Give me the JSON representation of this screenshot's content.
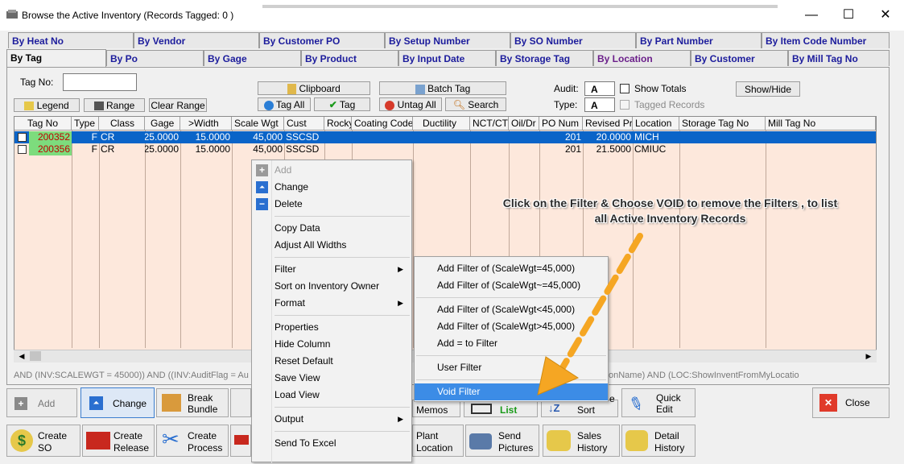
{
  "window": {
    "title": "Browse the Active Inventory  (Records Tagged:  0 )",
    "minimize_glyph": "—",
    "maximize_glyph": "☐",
    "close_glyph": "✕"
  },
  "tabs_row1": [
    "By Heat No",
    "By Vendor",
    "By Customer PO",
    "By Setup Number",
    "By SO Number",
    "By Part Number",
    "By Item Code Number"
  ],
  "tabs_row2": [
    "By Tag",
    "By Po",
    "By Gage",
    "By Product",
    "By Input Date",
    "By Storage Tag",
    "By Location",
    "By Customer",
    "By Mill Tag No"
  ],
  "filter_bar": {
    "tag_no_label": "Tag No:",
    "tag_no_value": "",
    "legend_label": "Legend",
    "range_label": "Range",
    "clear_range_label": "Clear Range",
    "clipboard_label": "Clipboard",
    "tag_all_label": "Tag All",
    "tag_label": "Tag",
    "batch_tag_label": "Batch Tag",
    "untag_all_label": "Untag All",
    "search_label": "Search",
    "audit_label": "Audit:",
    "audit_value": "A",
    "type_label": "Type:",
    "type_value": "A",
    "show_totals_label": "Show Totals",
    "tagged_records_label": "Tagged Records",
    "show_hide_label": "Show/Hide"
  },
  "grid": {
    "columns": [
      "Tag No",
      "Type",
      "Class",
      "Gage",
      ">Width",
      "Scale Wgt",
      "Cust",
      "Rocky",
      "Coating Code",
      "Ductility",
      "NCT/CT",
      "Oil/Dr",
      "PO Num",
      "Revised Pri",
      "Location",
      "Storage Tag No",
      "Mill Tag No"
    ],
    "rows": [
      {
        "tag_no": "200352",
        "type": "F",
        "class": "CR",
        "gage": "25.0000",
        "width": "15.0000",
        "scale_wgt": "45,000",
        "cust": "SSCSD",
        "po_num": "201",
        "revised_price": "20.0000",
        "location": "MICH",
        "selected": true
      },
      {
        "tag_no": "200356",
        "type": "F",
        "class": "CR",
        "gage": "25.0000",
        "width": "15.0000",
        "scale_wgt": "45,000",
        "cust": "SSCSD",
        "po_num": "201",
        "revised_price": "21.5000",
        "location": "CMIUC",
        "selected": false
      }
    ],
    "selected_color": "#0a64c8",
    "row_bg": "#fde8dc"
  },
  "filter_expression_left": "AND (INV:SCALEWGT = 45000)) AND ((INV:AuditFlag = Au",
  "filter_expression_right": "onName) AND (LOC:ShowInventFromMyLocatio",
  "context_menu": {
    "add": "Add",
    "change": "Change",
    "delete": "Delete",
    "copy_data": "Copy Data",
    "adjust_widths": "Adjust All Widths",
    "filter": "Filter",
    "sort_owner": "Sort on Inventory Owner",
    "format": "Format",
    "properties": "Properties",
    "hide_column": "Hide Column",
    "reset_default": "Reset Default",
    "save_view": "Save View",
    "load_view": "Load View",
    "output": "Output",
    "send_excel": "Send To Excel"
  },
  "filter_submenu": {
    "eq": "Add Filter of (ScaleWgt=45,000)",
    "neq": "Add Filter of (ScaleWgt~=45,000)",
    "lt": "Add Filter of (ScaleWgt<45,000)",
    "gt": "Add Filter of (ScaleWgt>45,000)",
    "add_eq": "Add = to Filter",
    "user": "User Filter",
    "void": "Void Filter"
  },
  "annotation": {
    "line1": "Click on the Filter & Choose VOID to remove the Filters , to list",
    "line2": "all Active Inventory Records"
  },
  "bottom_buttons": {
    "add": "Add",
    "change": "Change",
    "break_bundle_1": "Break",
    "break_bundle_2": "Bundle",
    "memos": "Memos",
    "list": "List",
    "sort": "Sort",
    "e_partial": "e",
    "quick_edit_1": "Quick",
    "quick_edit_2": "Edit",
    "close": "Close",
    "create_so_1": "Create",
    "create_so_2": "SO",
    "create_release_1": "Create",
    "create_release_2": "Release",
    "create_process_1": "Create",
    "create_process_2": "Process",
    "plant_location_1": "Plant",
    "plant_location_2": "Location",
    "send_pictures_1": "Send",
    "send_pictures_2": "Pictures",
    "sales_history_1": "Sales",
    "sales_history_2": "History",
    "detail_history_1": "Detail",
    "detail_history_2": "History"
  },
  "colors": {
    "arrow": "#f5a623",
    "tab_text": "#1c1c9c",
    "highlight": "#3c8ce6",
    "tag_cell": "#7ddc7d"
  }
}
